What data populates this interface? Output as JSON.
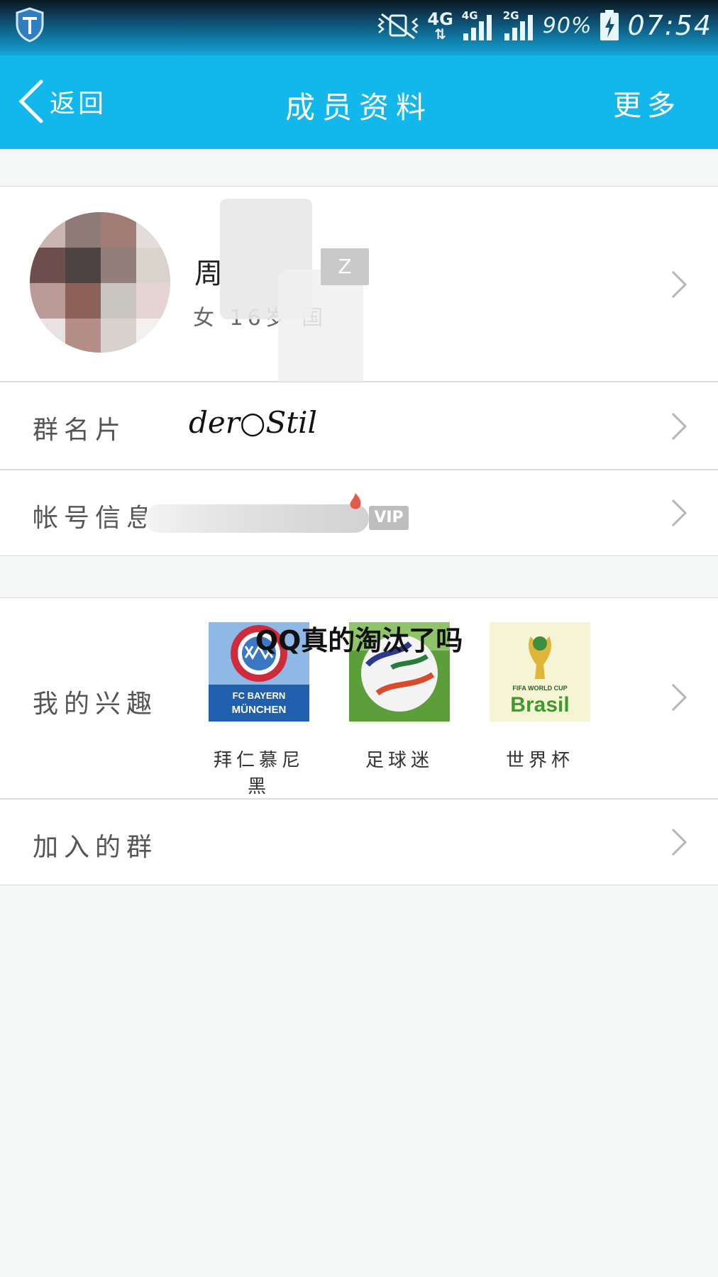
{
  "status_bar": {
    "network_1": "4G",
    "network_1_sub": "⇅",
    "signal_1": "4G",
    "signal_2": "2G",
    "battery_percent": "90%",
    "time": "07:54"
  },
  "header": {
    "back_label": "返回",
    "title": "成员资料",
    "more_label": "更多"
  },
  "profile": {
    "name": "周",
    "badge": "Z",
    "details": "女 16岁 国"
  },
  "group_card": {
    "label": "群名片",
    "value": "der○Stil"
  },
  "account_info": {
    "label": "帐号信息",
    "vip_badge": "VIP"
  },
  "interests": {
    "label": "我的兴趣",
    "items": [
      {
        "label": "拜仁慕尼黑",
        "image_text_top": "FC BAYERN",
        "image_text_bottom": "MÜNCHEN"
      },
      {
        "label": "足球迷"
      },
      {
        "label": "世界杯",
        "image_text_top": "FIFA WORLD CUP",
        "image_text_bottom": "Brasil"
      }
    ]
  },
  "overlay_caption": "QQ真的淘汰了吗",
  "joined_groups": {
    "label": "加入的群"
  },
  "colors": {
    "title_bar": "#12b7eb",
    "background": "#f5f6f6",
    "card": "#ffffff"
  }
}
